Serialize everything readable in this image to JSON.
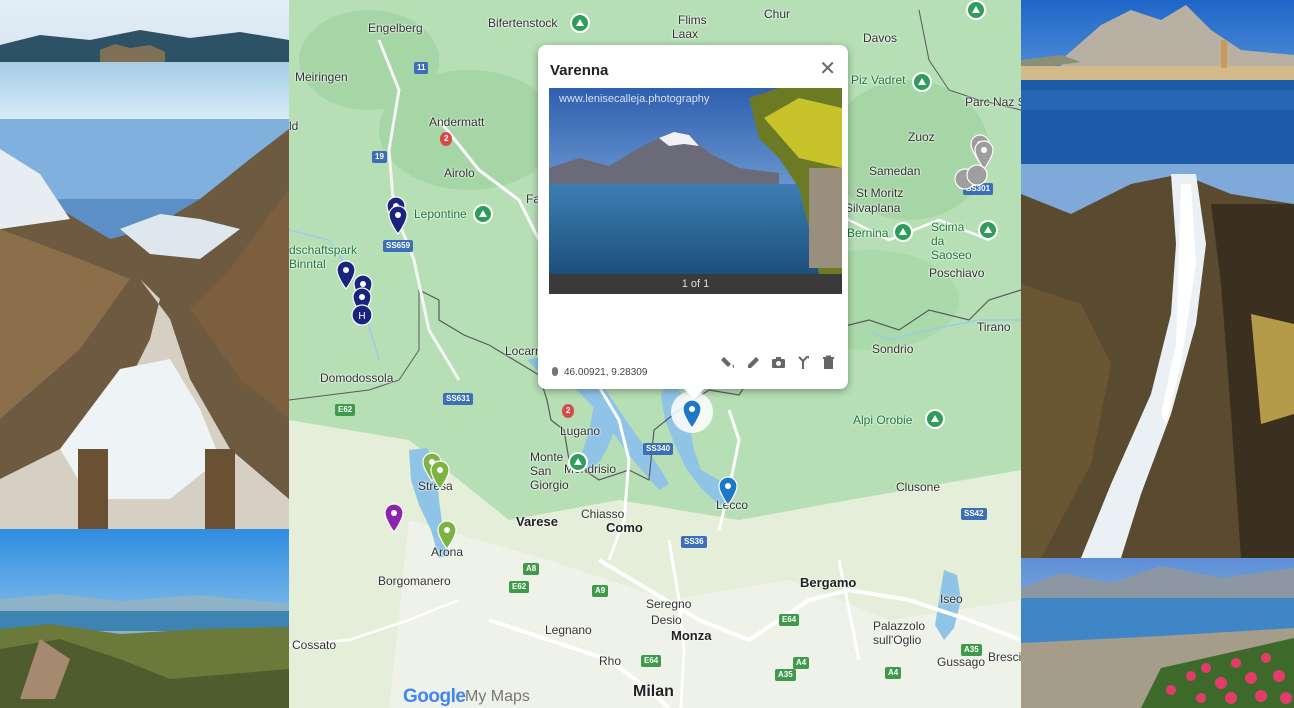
{
  "popup": {
    "title": "Varenna",
    "close": "✕",
    "watermark": "www.lenisecalleja.photography",
    "pager": "1 of 1",
    "coordinates": "46.00921, 9.28309",
    "tools": [
      "style-icon",
      "edit-icon",
      "camera-icon",
      "directions-icon",
      "delete-icon"
    ]
  },
  "map": {
    "places": {
      "bifertenstock": "Bifertenstock",
      "flims": "Flims",
      "laax": "Laax",
      "chur": "Chur",
      "davos": "Davos",
      "engelberg": "Engelberg",
      "meiringen": "Meiringen",
      "andermatt": "Andermatt",
      "airolo": "Airolo",
      "piz_vadret": "Piz Vadret",
      "parc": "Parc Naz Svizz",
      "zuoz": "Zuoz",
      "samedan": "Samedan",
      "st_moritz": "St Moritz",
      "silvaplana": "Silvaplana",
      "lepontine": "Lepontine",
      "faido": "Faido",
      "bernina": "Bernina",
      "scima": "Scima da Saoseo",
      "landschaftspark": "dschaftspark Binntal",
      "poschiavo": "Poschiavo",
      "tirano": "Tirano",
      "sondrio": "Sondrio",
      "locarno": "Locarn",
      "domodossola": "Domodossola",
      "lugano": "Lugano",
      "alpi_orobie": "Alpi Orobie",
      "monte_san_giorgio": "Monte San Giorgio",
      "mendrisio": "Mendrisio",
      "stresa": "Stresa",
      "chiasso": "Chiasso",
      "varese": "Varese",
      "como": "Como",
      "lecco": "Lecco",
      "clusone": "Clusone",
      "arona": "Arona",
      "borgomanero": "Borgomanero",
      "bergamo": "Bergamo",
      "seregno": "Seregno",
      "desio": "Desio",
      "legnano": "Legnano",
      "monza": "Monza",
      "iseo": "Iseo",
      "palazzolo": "Palazzolo sull'Oglio",
      "cossato": "Cossato",
      "rho": "Rho",
      "gussago": "Gussago",
      "brescia": "Bresci",
      "milan": "Milan",
      "ld": "ld"
    },
    "roads": [
      "11",
      "19",
      "SS659",
      "E62",
      "SS631",
      "SS340",
      "A9",
      "A8",
      "E62",
      "A4",
      "E64",
      "E64",
      "SS36",
      "SS42",
      "A35",
      "A35",
      "A4",
      "SS301",
      "2",
      "2"
    ],
    "brand": "Google",
    "brand_suffix": "My Maps"
  },
  "colors": {
    "marker_navy": "#1a237e",
    "marker_blue": "#1e78c8",
    "marker_green": "#7cb342",
    "marker_purple": "#8e24aa",
    "marker_grey": "#9e9e9e",
    "park_green": "#2e9d5b"
  }
}
